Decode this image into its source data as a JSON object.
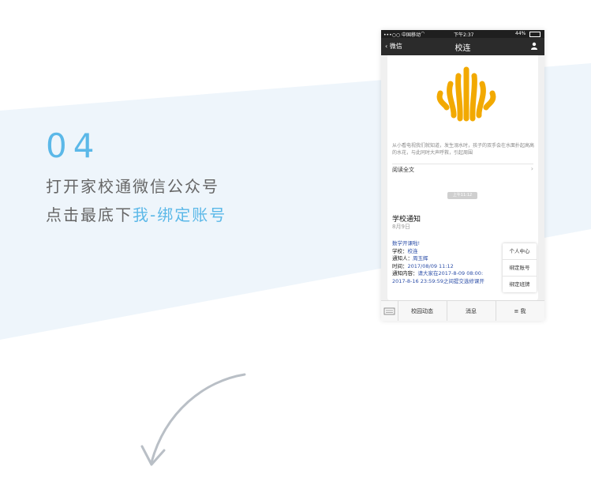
{
  "step": {
    "number": "04",
    "line1": "打开家校通微信公众号",
    "line2_prefix": "点击最底下",
    "line2_highlight": "我-绑定账号"
  },
  "colors": {
    "accent": "#5bb8e8",
    "text_gray": "#666666",
    "band": "#eef5fb",
    "logo": "#f2a900"
  },
  "phone": {
    "statusbar": {
      "carrier": "•••○○ 中国移动",
      "wifi_icon": "wifi-icon",
      "time": "下午2:37",
      "battery": "44%"
    },
    "navbar": {
      "back_label": "微信",
      "title": "校连",
      "user_icon": "user-icon"
    },
    "article": {
      "logo_icon": "xiaolian-logo-icon",
      "description": "从小看电视我们就知道，发生溺水时，孩子的双手会在水面扑起高高的水花，与此同时大声呼救，引起周围",
      "read_all": "阅读全文"
    },
    "timestamp": "上午11:12",
    "notice": {
      "title": "学校通知",
      "date": "8月9日",
      "headline": "数学开课啦!",
      "school_label": "学校：",
      "school_value": "校连",
      "notifier_label": "通知人：",
      "notifier_value": "周玉辉",
      "time_label": "时间：",
      "time_value": "2017/08/09 11:12",
      "content_label": "通知内容：",
      "content_value1": "请大家在2017-8-09 08:00:",
      "content_value2": "2017-8-16 23:59:59之间提交选修课开"
    },
    "popup_menu": [
      "个人中心",
      "绑定账号",
      "绑定班牌"
    ],
    "tabbar": {
      "keyboard_icon": "keyboard-icon",
      "tabs": [
        "校园动态",
        "消息",
        "≡ 我"
      ]
    }
  }
}
